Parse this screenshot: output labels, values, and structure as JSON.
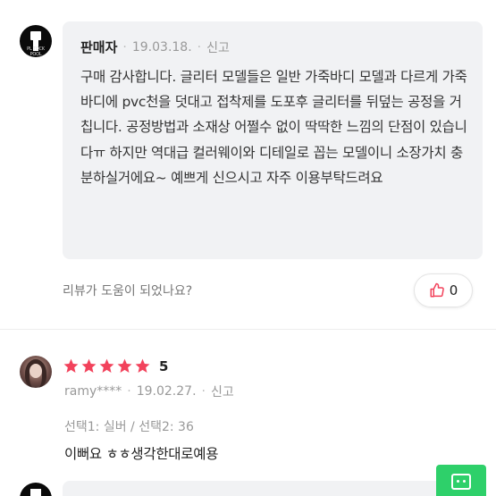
{
  "seller_reply": {
    "name": "판매자",
    "date": "19.03.18.",
    "report_label": "신고",
    "text": "구매 감사합니다. 글리터 모델들은 일반 가죽바디 모델과 다르게 가죽바디에 pvc천을 덧대고 접착제를 도포후 글리터를 뒤덮는 공정을 거칩니다. 공정방법과 소재상 어쩔수 없이 딱딱한 느낌의 단점이 있습니다ㅠ 하지만 역대급 컬러웨이와 디테일로 꼽는 모델이니 소장가치 충분하실거에요~ 예쁘게 신으시고 자주 이용부탁드려요",
    "avatar_caption": "PL TOCK POOL"
  },
  "helpful": {
    "question": "리뷰가 도움이 되었나요?",
    "count": "0",
    "icon": "thumbs-up-icon"
  },
  "review": {
    "rating": "5",
    "stars": 5,
    "username": "ramy****",
    "date": "19.02.27.",
    "report_label": "신고",
    "option": "선택1: 실버 / 선택2: 36",
    "text": "이뻐요 ㅎㅎ생각한대로예용"
  },
  "colors": {
    "star": "#f2425b",
    "like_icon": "#f2425b",
    "fab": "#2ed06a",
    "bubble_bg": "#f1f2f4"
  }
}
